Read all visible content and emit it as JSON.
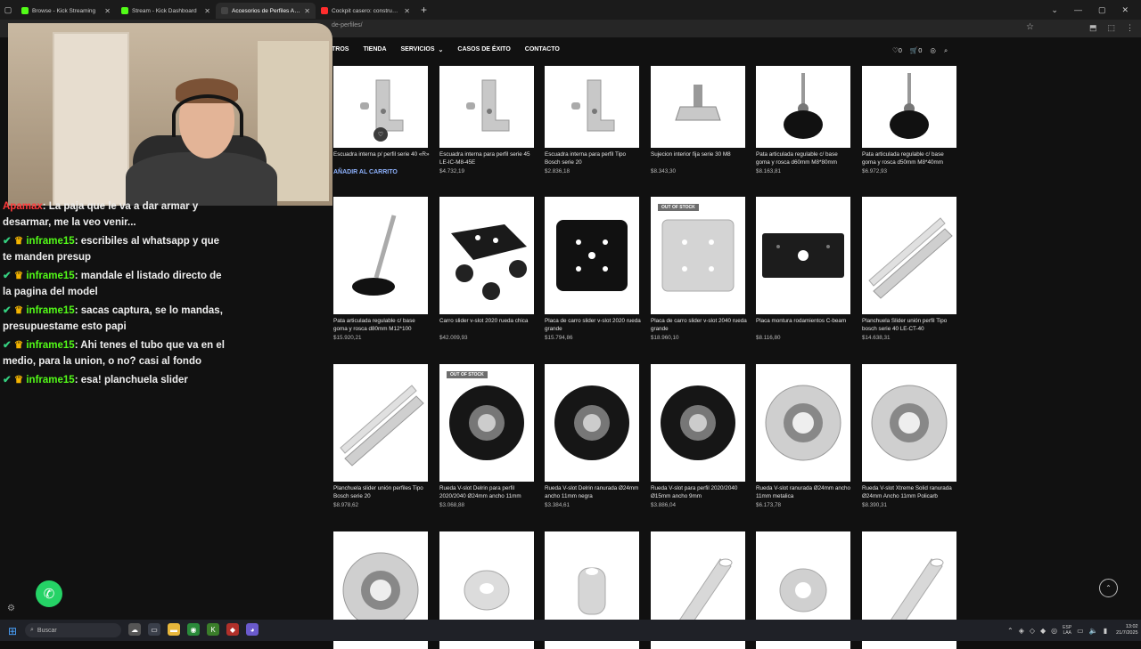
{
  "browser": {
    "tabs": [
      {
        "label": "Browse - Kick Streaming",
        "color": "#53fc18",
        "active": false
      },
      {
        "label": "Stream - Kick Dashboard",
        "color": "#53fc18",
        "active": false
      },
      {
        "label": "Accesorios de Perfiles Archives",
        "color": "#444444",
        "active": true
      },
      {
        "label": "Cockpit casero: construye tu",
        "color": "#ff2d2d",
        "active": false
      }
    ],
    "new_tab": "+",
    "url": "de-perfiles/"
  },
  "nav": {
    "items": [
      "TROS",
      "TIENDA",
      "SERVICIOS",
      "CASOS DE ÉXITO",
      "CONTACTO"
    ],
    "wishlist_count": "0",
    "cart_count": "0"
  },
  "products": [
    {
      "name": "Escuadra interna p/ perfil serie 40 «R»",
      "price": "",
      "action": "AÑADIR AL CARRITO",
      "img": "bracket",
      "oos": false
    },
    {
      "name": "Escuadra interna para perfil serie 45 LE-IC-M8-45E",
      "price": "$4.732,19",
      "img": "bracket",
      "oos": false
    },
    {
      "name": "Escuadra interna para perfil Tipo Bosch serie 20",
      "price": "$2.836,18",
      "img": "bracket",
      "oos": false
    },
    {
      "name": "Sujecion interior fija serie 30 M8",
      "price": "$8.343,30",
      "img": "tnut",
      "oos": false
    },
    {
      "name": "Pata articulada regulable c/ base goma y rosca d60mm M8*80mm",
      "price": "$8.163,81",
      "img": "foot",
      "oos": false
    },
    {
      "name": "Pata articulada regulable c/ base goma y rosca d50mm M8*40mm",
      "price": "$6.972,93",
      "img": "foot",
      "oos": false
    },
    {
      "name": "Pata articulada regulable c/ base goma y rosca d80mm M12*100",
      "price": "$15.920,21",
      "img": "leg",
      "oos": false
    },
    {
      "name": "Carro slider v-slot 2020 rueda chica",
      "price": "$42.009,93",
      "img": "cart",
      "oos": false
    },
    {
      "name": "Placa de carro slider v-slot 2020 rueda grande",
      "price": "$15.794,86",
      "img": "plate-black",
      "oos": false
    },
    {
      "name": "Placa de carro slider v-slot 2040 rueda grande",
      "price": "$18.960,10",
      "img": "plate-silver",
      "oos": true
    },
    {
      "name": "Placa montura rodamientos C-beam",
      "price": "$8.116,80",
      "img": "block",
      "oos": false
    },
    {
      "name": "Planchuela Slider unión perfil Tipo bosch serie 40 LE-CT-40",
      "price": "$14.638,31",
      "img": "rail",
      "oos": false
    },
    {
      "name": "Planchuela slider unión perfiles Tipo Bosch serie 20",
      "price": "$8.978,62",
      "img": "rail",
      "oos": false
    },
    {
      "name": "Rueda V-slot Delrin para perfil 2020/2040 Ø24mm ancho 11mm",
      "price": "$3.068,88",
      "img": "wheel-black",
      "oos": true
    },
    {
      "name": "Rueda V-slot Delrin ranurada Ø24mm ancho 11mm negra",
      "price": "$3.384,61",
      "img": "wheel-black",
      "oos": false
    },
    {
      "name": "Rueda V-slot para perfil 2020/2040 Ø15mm ancho 9mm",
      "price": "$3.886,04",
      "img": "wheel-black",
      "oos": false
    },
    {
      "name": "Rueda V-slot ranurada Ø24mm ancho 11mm metalica",
      "price": "$6.173,78",
      "img": "wheel-silver",
      "oos": false
    },
    {
      "name": "Rueda V-slot Xtreme Solid ranurada Ø24mm Ancho 11mm Policarb",
      "price": "$8.390,31",
      "img": "wheel-silver",
      "oos": false
    },
    {
      "name": "",
      "price": "",
      "img": "wheel-silver",
      "oos": false
    },
    {
      "name": "",
      "price": "",
      "img": "spacer",
      "oos": false
    },
    {
      "name": "",
      "price": "",
      "img": "spacer-tall",
      "oos": false
    },
    {
      "name": "",
      "price": "",
      "img": "tube",
      "oos": false
    },
    {
      "name": "",
      "price": "",
      "img": "washer",
      "oos": false
    },
    {
      "name": "",
      "price": "",
      "img": "tube",
      "oos": false
    }
  ],
  "oos_label": "OUT OF STOCK",
  "chat": [
    {
      "user": "Apamax",
      "text": ": La paja que le va a dar armar y desarmar, me la veo venir...",
      "red": true
    },
    {
      "user": "inframe15",
      "text": ": escribiles al whatsapp y que te manden presup",
      "red": false
    },
    {
      "user": "inframe15",
      "text": ": mandale el listado directo de la pagina del model",
      "red": false
    },
    {
      "user": "inframe15",
      "text": ": sacas captura, se lo mandas, presupuestame esto papi",
      "red": false
    },
    {
      "user": "inframe15",
      "text": ": Ahi tenes el tubo que va en el medio, para la union, o no? casi al fondo",
      "red": false
    },
    {
      "user": "inframe15",
      "text": ": esa! planchuela slider",
      "red": false
    }
  ],
  "taskbar": {
    "search_placeholder": "Buscar",
    "lang_top": "ESP",
    "lang_bottom": "LAA",
    "time": "13:02",
    "date": "21/7/2025"
  }
}
